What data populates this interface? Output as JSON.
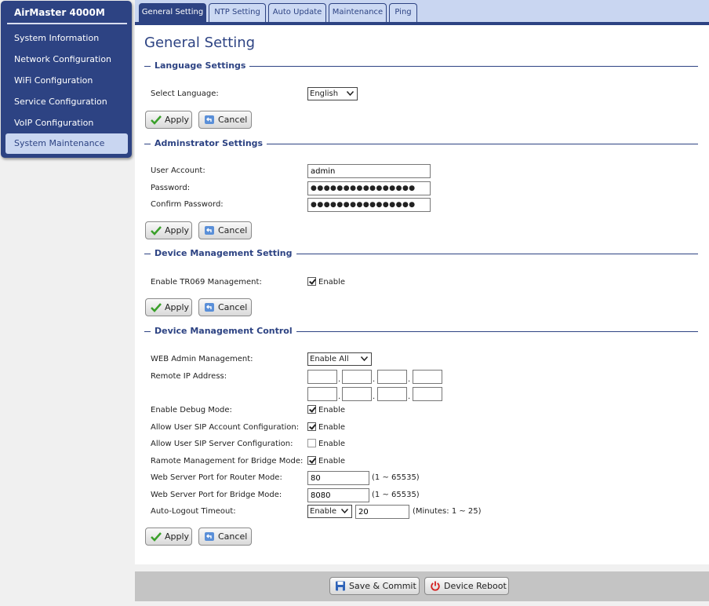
{
  "sidebar": {
    "title": "AirMaster 4000M",
    "items": [
      {
        "label": "System Information"
      },
      {
        "label": "Network Configuration"
      },
      {
        "label": "WiFi Configuration"
      },
      {
        "label": "Service Configuration"
      },
      {
        "label": "VoIP Configuration"
      },
      {
        "label": "System Maintenance"
      }
    ],
    "active_item": "System Maintenance"
  },
  "tabs": [
    {
      "label": "General Setting"
    },
    {
      "label": "NTP Setting"
    },
    {
      "label": "Auto Update"
    },
    {
      "label": "Maintenance"
    },
    {
      "label": "Ping"
    }
  ],
  "active_tab": "General Setting",
  "page_title": "General Setting",
  "buttons": {
    "apply": "Apply",
    "cancel": "Cancel",
    "save": "Save & Commit",
    "reboot": "Device Reboot"
  },
  "language": {
    "section": "Language Settings",
    "select_label": "Select Language:",
    "selected": "English"
  },
  "admin": {
    "section": "Adminstrator Settings",
    "user_label": "User Account:",
    "user_value": "admin",
    "password_label": "Password:",
    "password_value": "●●●●●●●●●●●●●●●●",
    "confirm_label": "Confirm Password:",
    "confirm_value": "●●●●●●●●●●●●●●●●"
  },
  "mgmt": {
    "section": "Device Management Setting",
    "tr069_label": "Enable TR069 Management:",
    "tr069_checked": true,
    "enable_text": "Enable"
  },
  "control": {
    "section": "Device Management Control",
    "web_admin_label": "WEB Admin Management:",
    "web_admin_value": "Enable All",
    "remote_ip_label": "Remote IP Address:",
    "remote_ip_1": [
      "",
      "",
      "",
      ""
    ],
    "remote_ip_2": [
      "",
      "",
      "",
      ""
    ],
    "debug_label": "Enable Debug Mode:",
    "debug_checked": true,
    "sip_account_label": "Allow User SIP Account Configuration:",
    "sip_account_checked": true,
    "sip_server_label": "Allow User SIP Server Configuration:",
    "sip_server_checked": false,
    "bridge_remote_label": "Ramote Management for Bridge Mode:",
    "bridge_remote_checked": true,
    "router_port_label": "Web Server Port for Router Mode:",
    "router_port_value": "80",
    "router_port_hint": "(1 ~ 65535)",
    "bridge_port_label": "Web Server Port for Bridge Mode:",
    "bridge_port_value": "8080",
    "bridge_port_hint": "(1 ~ 65535)",
    "logout_label": "Auto-Logout Timeout:",
    "logout_select": "Enable",
    "logout_value": "20",
    "logout_hint": "(Minutes: 1 ~ 25)",
    "enable_text": "Enable"
  },
  "colors": {
    "brand": "#2d4383",
    "tab_bg": "#c9d6f1",
    "footer": "#c4c4c4"
  }
}
